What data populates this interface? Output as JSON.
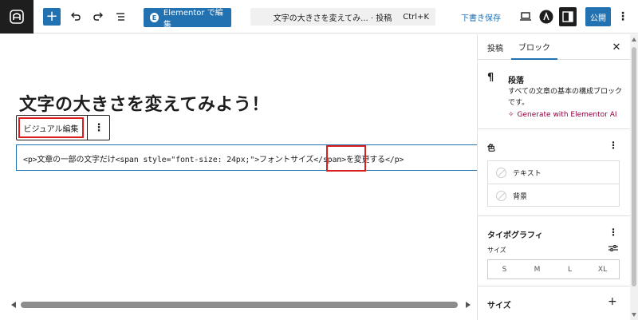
{
  "topbar": {
    "logo_icon": "wordpress-site-icon",
    "elementor_label": "Elementor で編集",
    "elementor_badge": "E",
    "command_title": "文字の大きさを変えてみ... · 投稿",
    "command_shortcut": "Ctrl+K",
    "draft_label": "下書き保存",
    "publish_label": "公開",
    "astra_badge": "A"
  },
  "canvas": {
    "post_title": "文字の大きさを変えてみよう！",
    "visual_edit_label": "ビジュアル編集",
    "html_code": "<p>文章の一部の文字だけ<span style=\"font-size: 24px;\">フォントサイズ</span>を変更する</p>"
  },
  "sidebar": {
    "tab_post": "投稿",
    "tab_block": "ブロック",
    "block_name": "段落",
    "block_description": "すべての文章の基本の構成ブロックです。",
    "ai_link": "Generate with Elementor AI",
    "color_title": "色",
    "color_text": "テキスト",
    "color_background": "背景",
    "typography_title": "タイポグラフィ",
    "size_label": "サイズ",
    "size_options": [
      "S",
      "M",
      "L",
      "XL"
    ],
    "size_section_title": "サイズ"
  },
  "colors": {
    "primary": "#2271b1",
    "highlight": "#d81e1e",
    "ai": "#93003f"
  }
}
